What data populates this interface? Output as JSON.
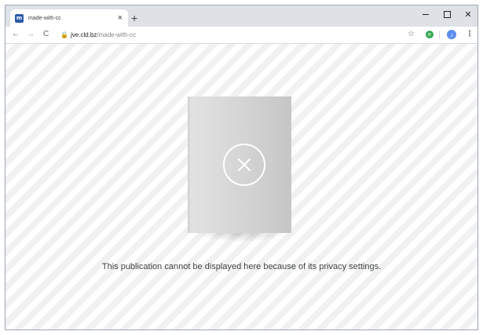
{
  "browser": {
    "tab": {
      "favicon_text": "m",
      "title": "made-with-cc",
      "close_glyph": "×"
    },
    "new_tab_glyph": "+",
    "window_controls": {
      "close_glyph": "✕"
    },
    "toolbar": {
      "back_glyph": "←",
      "forward_glyph": "→",
      "reload_glyph": "C",
      "lock_glyph": "🔒",
      "url_host": "jve.cld.bz",
      "url_path": "/made-with-cc",
      "bookmark_glyph": "☆",
      "extension_glyph": "e",
      "profile_glyph": "♪",
      "menu_glyph": "⋮"
    }
  },
  "page": {
    "message": "This publication cannot be displayed here because of its privacy settings.",
    "icons": {
      "publication": "book-icon",
      "error": "close-circle-icon"
    },
    "colors": {
      "accent": "#2b5aa9",
      "stripe": "#f1f1f1"
    }
  }
}
